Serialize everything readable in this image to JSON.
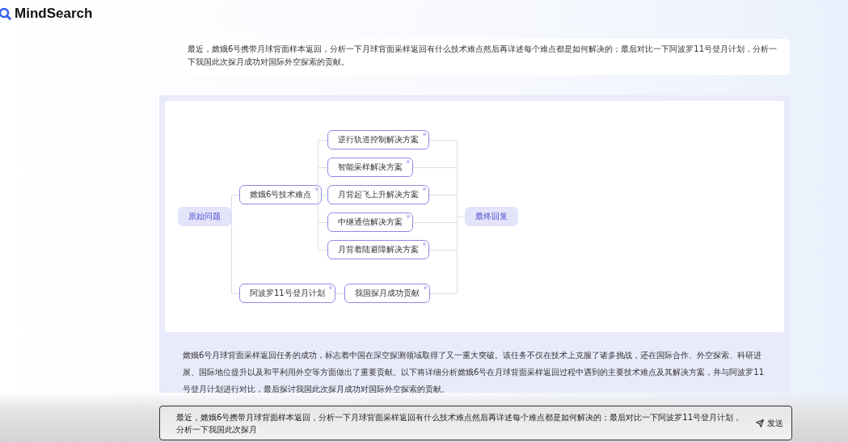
{
  "app": {
    "name": "MindSearch"
  },
  "question": "最近，嫦娥6号携带月球背面样本返回，分析一下月球背面采样返回有什么技术难点然后再详述每个难点都是如何解决的；最后对比一下阿波罗11号登月计划，分析一下我国此次探月成功对国际外空探索的贡献。",
  "mindmap": {
    "root": "原始问题",
    "final": "最终回复",
    "branches": [
      {
        "label": "嫦娥6号技术难点",
        "children": [
          "逆行轨道控制解决方案",
          "智能采样解决方案",
          "月背起飞上升解决方案",
          "中继通信解决方案",
          "月背着陆避障解决方案"
        ]
      },
      {
        "label": "阿波罗11号登月计划",
        "children": [
          "我国探月成功贡献"
        ]
      }
    ]
  },
  "answer": "嫦娥6号月球背面采样返回任务的成功，标志着中国在深空探测领域取得了又一重大突破。该任务不仅在技术上克服了诸多挑战，还在国际合作、外空探索、科研进展、国际地位提升以及和平利用外空等方面做出了重要贡献。以下将详细分析嫦娥6号在月球背面采样返回过程中遇到的主要技术难点及其解决方案，并与阿波罗11号登月计划进行对比，最后探讨我国此次探月成功对国际外空探索的贡献。",
  "input": {
    "value": "最近，嫦娥6号携带月球背面样本返回，分析一下月球背面采样返回有什么技术难点然后再详述每个难点都是如何解决的；最后对比一下阿波罗11号登月计划，分析一下我国此次探月",
    "send": "发送"
  }
}
